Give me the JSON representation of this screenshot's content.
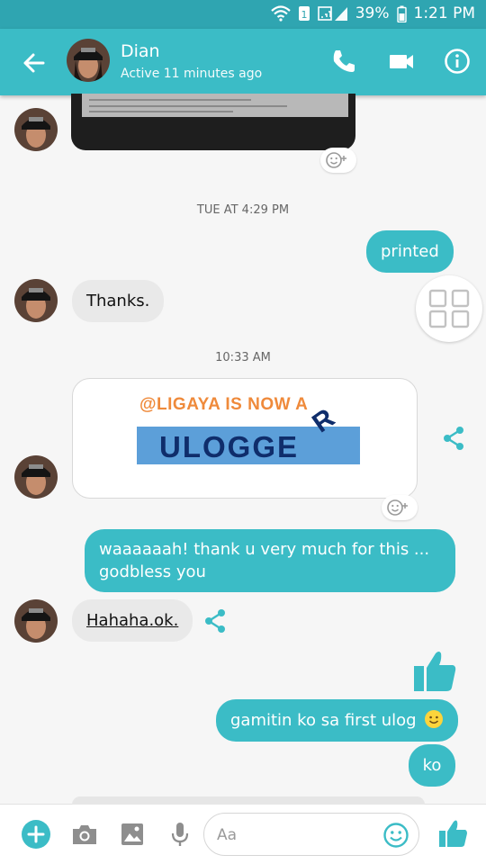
{
  "status_bar": {
    "battery": "39%",
    "time": "1:21 PM"
  },
  "header": {
    "contact_name": "Dian",
    "presence": "Active 11 minutes ago",
    "back_icon": "arrow-left-icon",
    "call_icon": "phone-icon",
    "video_icon": "video-camera-icon",
    "info_icon": "info-icon"
  },
  "conversation": {
    "timestamp_1": "TUE AT 4:29 PM",
    "timestamp_2": "10:33 AM",
    "messages": [
      {
        "from": "me",
        "text": "printed"
      },
      {
        "from": "them",
        "text": "Thanks."
      },
      {
        "from": "me",
        "text": "waaaaaah! thank u very much for this ... godbless you"
      },
      {
        "from": "them",
        "text": "Hahaha.ok."
      },
      {
        "from": "me",
        "text": "gamitin ko sa first ulog"
      },
      {
        "from": "me",
        "text": "ko"
      }
    ],
    "shared_image": {
      "headline": "@LIGAYA IS NOW A",
      "logo_text": "ULOGGE",
      "logo_tail": "R"
    }
  },
  "composer": {
    "placeholder": "Aa"
  },
  "colors": {
    "accent": "#3bbcc6",
    "status_bar": "#2fa5b1",
    "incoming_bubble": "#e9e9e9",
    "background": "#f6f6f6"
  }
}
